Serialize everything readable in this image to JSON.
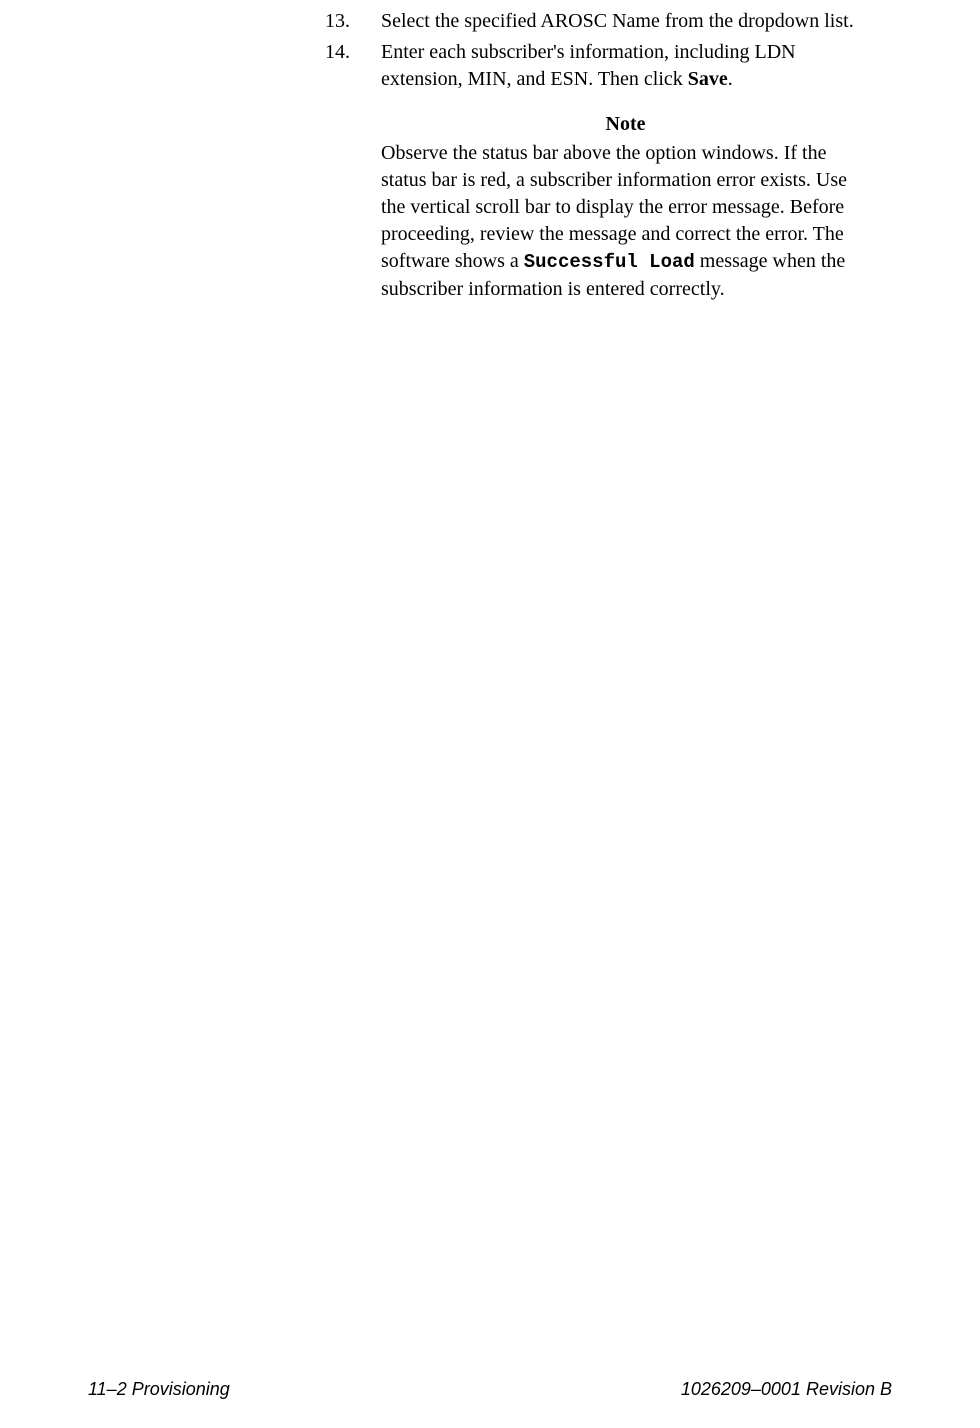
{
  "steps": [
    {
      "number": "13.",
      "text": "Select the specified AROSC Name from the dropdown list."
    },
    {
      "number": "14.",
      "text_before": "Enter each subscriber's information, including LDN extension, MIN, and ESN. Then click ",
      "text_bold": "Save",
      "text_after": "."
    }
  ],
  "note": {
    "heading": "Note",
    "body_before": "Observe the status bar above the option windows. If the status bar is red, a subscriber information error exists. Use the vertical scroll bar to display the error message. Before proceeding, review the message and correct the error. The software shows a ",
    "body_mono": "Successful Load",
    "body_after": " message when the subscriber information is entered correctly."
  },
  "footer": {
    "left": "11–2  Provisioning",
    "right": "1026209–0001  Revision B"
  }
}
